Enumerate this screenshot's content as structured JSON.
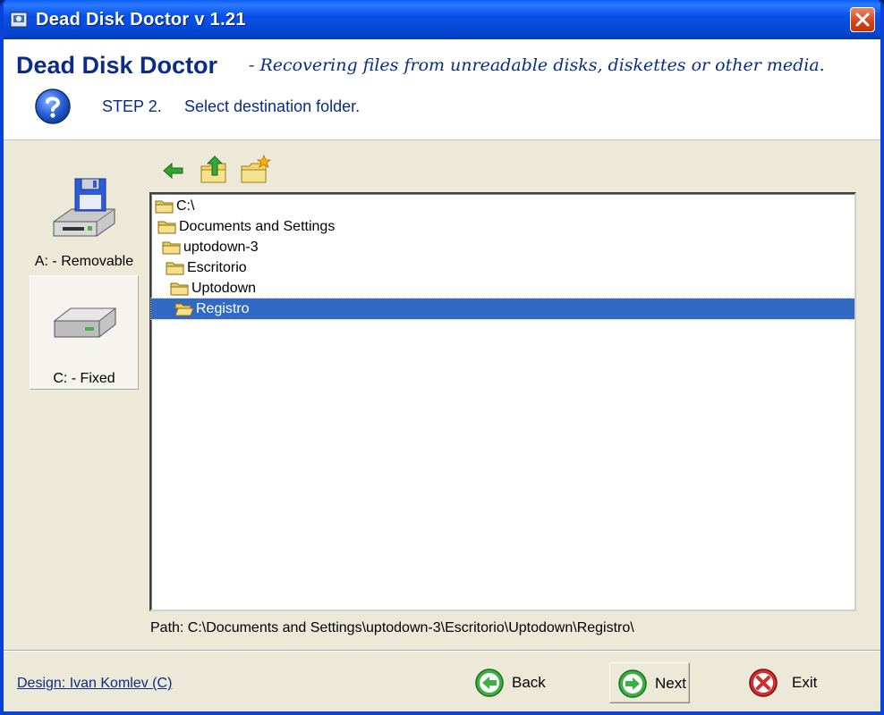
{
  "window": {
    "title": "Dead Disk Doctor   v 1.21"
  },
  "header": {
    "app_name": "Dead Disk Doctor",
    "subtitle": "- Recovering files from unreadable disks, diskettes or other media.",
    "step": "STEP 2.",
    "step_description": "Select destination folder."
  },
  "drives": [
    {
      "label": "A: - Removable",
      "icon": "floppy-drive-icon"
    },
    {
      "label": "C: - Fixed",
      "icon": "hard-drive-icon",
      "selected": true
    }
  ],
  "toolbar": {
    "back_icon": "back-arrow-icon",
    "up_icon": "folder-up-icon",
    "new_icon": "new-folder-icon"
  },
  "tree": {
    "items": [
      {
        "label": "C:\\"
      },
      {
        "label": "Documents and Settings"
      },
      {
        "label": "uptodown-3"
      },
      {
        "label": "Escritorio"
      },
      {
        "label": "Uptodown"
      },
      {
        "label": "Registro",
        "selected": true
      }
    ]
  },
  "path_text": "Path: C:\\Documents and Settings\\uptodown-3\\Escritorio\\Uptodown\\Registro\\",
  "footer": {
    "design_credit": "Design: Ivan Komlev (C)",
    "back_label": "Back",
    "next_label": "Next",
    "exit_label": "Exit"
  },
  "colors": {
    "accent": "#0a2c86",
    "selection": "#316ac5",
    "titlebar": "#0a52e8"
  }
}
